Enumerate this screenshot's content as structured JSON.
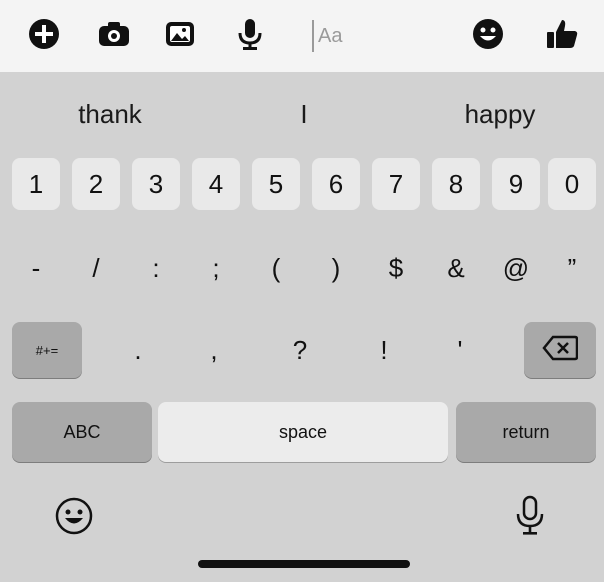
{
  "composer": {
    "input_placeholder": "Aa",
    "icons": [
      "plus-icon",
      "camera-icon",
      "gallery-icon",
      "microphone-icon",
      "emoji-icon",
      "thumbs-up-icon"
    ]
  },
  "suggestions": [
    "thank",
    "I",
    "happy"
  ],
  "rows": {
    "digits": [
      "1",
      "2",
      "3",
      "4",
      "5",
      "6",
      "7",
      "8",
      "9",
      "0"
    ],
    "symbols": [
      "-",
      "/",
      ":",
      ";",
      "(",
      ")",
      "$",
      "&",
      "@",
      "”"
    ],
    "punct": [
      ".",
      ",",
      "?",
      "!",
      "'"
    ]
  },
  "keys": {
    "more_symbols": "#+=",
    "abc": "ABC",
    "space": "space",
    "return": "return"
  }
}
